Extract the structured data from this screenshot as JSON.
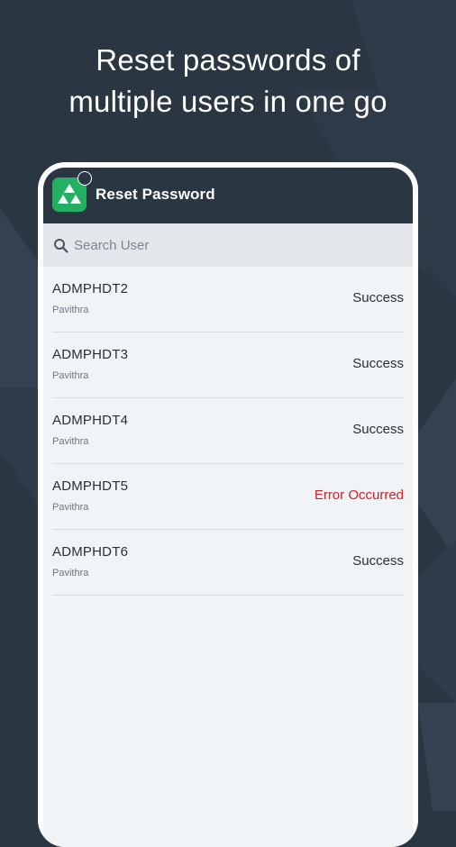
{
  "promo": {
    "headline_line1": "Reset passwords of",
    "headline_line2": "multiple users in one go"
  },
  "appbar": {
    "title": "Reset Password",
    "logo_icon": "triangles-logo-icon",
    "brand_color": "#23b062",
    "bar_color": "#2a3642"
  },
  "search": {
    "placeholder": "Search User",
    "value": "",
    "icon": "search-icon"
  },
  "users": [
    {
      "id": "ADMPHDT2",
      "name": "Pavithra",
      "status": "Success",
      "is_error": false
    },
    {
      "id": "ADMPHDT3",
      "name": "Pavithra",
      "status": "Success",
      "is_error": false
    },
    {
      "id": "ADMPHDT4",
      "name": "Pavithra",
      "status": "Success",
      "is_error": false
    },
    {
      "id": "ADMPHDT5",
      "name": "Pavithra",
      "status": "Error Occurred",
      "is_error": true
    },
    {
      "id": "ADMPHDT6",
      "name": "Pavithra",
      "status": "Success",
      "is_error": false
    }
  ],
  "colors": {
    "background": "#2a3642",
    "error": "#d0202a",
    "list_bg": "#f1f4f7"
  }
}
